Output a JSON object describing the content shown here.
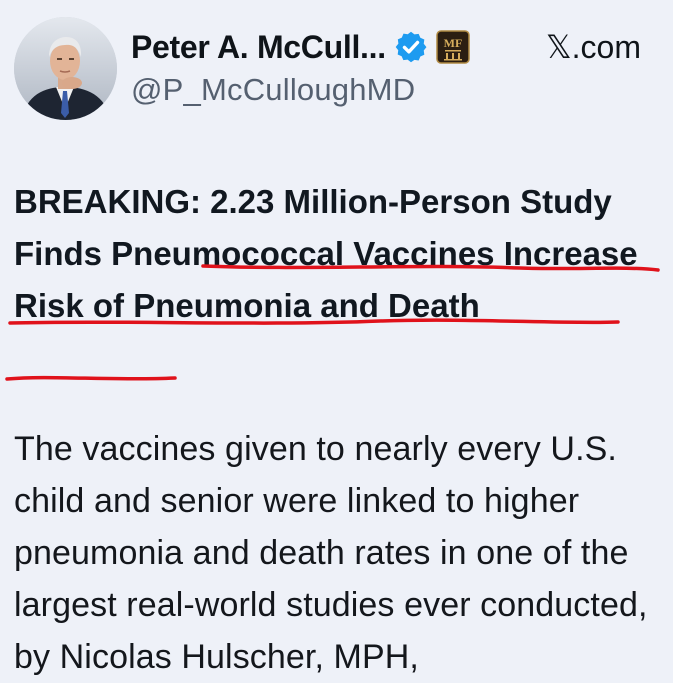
{
  "author": {
    "name": "Peter A. McCull...",
    "handle": "@P_McCulloughMD",
    "verified": true,
    "avatar": "man-in-suit-portrait",
    "org_badge": "MF"
  },
  "site": "𝕏.com",
  "post": {
    "headline": "BREAKING: 2.23 Million-Person Study Finds Pneumococcal Vaccines Increase Risk of Pneumonia and Death",
    "body": "The vaccines given to nearly every U.S. child and senior were linked to higher pneumonia and death rates in one of the largest real-world studies ever conducted, by Nicolas Hulscher, MPH,"
  },
  "colors": {
    "background": "#eef1f8",
    "verified": "#1d9bf0",
    "underline": "#e0121b",
    "badge_bg": "#2b1e12",
    "badge_gold": "#d6ad5c"
  },
  "icons": [
    "verified-icon",
    "org-badge-icon"
  ]
}
